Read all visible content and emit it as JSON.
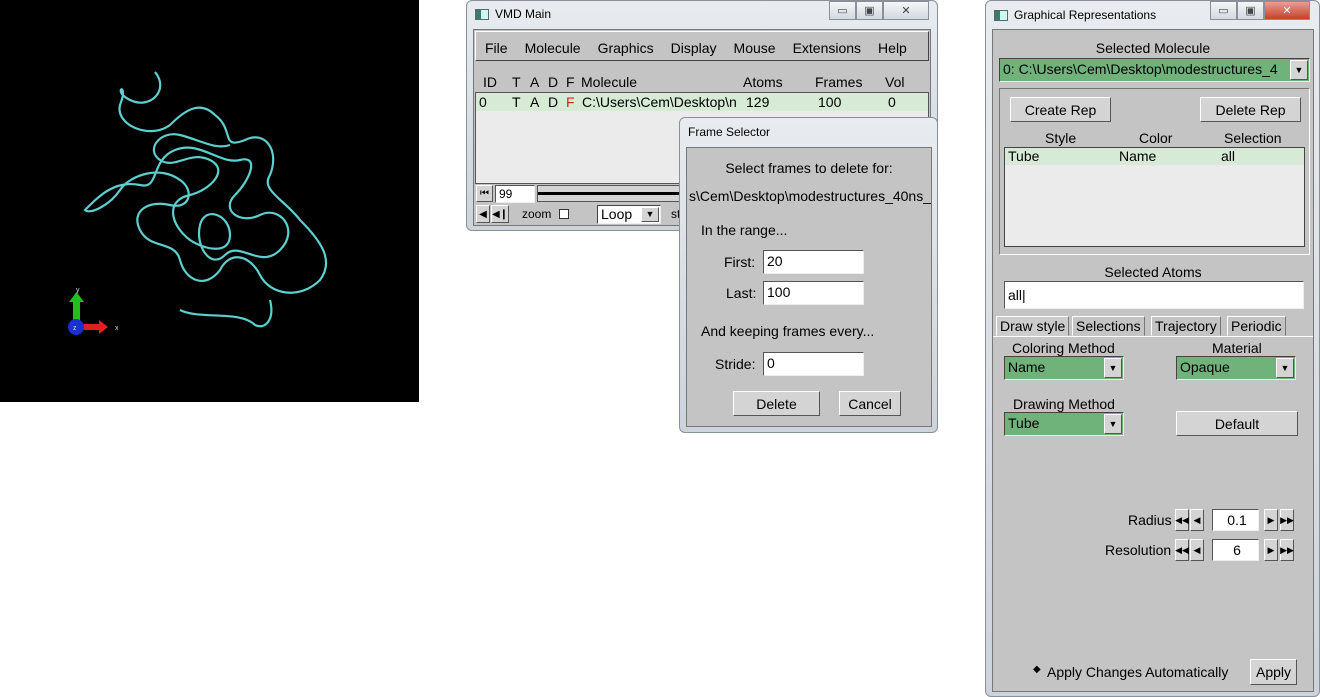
{
  "viewer": {
    "axis_labels": {
      "x": "x",
      "y": "y",
      "z": "z"
    },
    "molecule_color": "#5ccfcf"
  },
  "vmd_main": {
    "title": "VMD Main",
    "menu": [
      "File",
      "Molecule",
      "Graphics",
      "Display",
      "Mouse",
      "Extensions",
      "Help"
    ],
    "columns": [
      "ID",
      "T",
      "A",
      "D",
      "F",
      "Molecule",
      "Atoms",
      "Frames",
      "Vol"
    ],
    "rows": [
      {
        "id": "0",
        "t": "T",
        "a": "A",
        "d": "D",
        "f": "F",
        "molecule": "C:\\Users\\Cem\\Desktop\\n",
        "atoms": "129",
        "frames": "100",
        "vol": "0"
      }
    ],
    "frame_value": "99",
    "zoom_label": "zoom",
    "loop_mode": "Loop",
    "step_label": "st"
  },
  "frame_selector": {
    "title": "Frame Selector",
    "prompt": "Select frames to delete for:",
    "molecule_path": "s\\Cem\\Desktop\\modestructures_40ns_",
    "range_label": "In the range...",
    "first_label": "First:",
    "first_value": "20",
    "last_label": "Last:",
    "last_value": "100",
    "keep_label": "And keeping frames every...",
    "stride_label": "Stride:",
    "stride_value": "0",
    "delete_label": "Delete",
    "cancel_label": "Cancel"
  },
  "graph_reps": {
    "title": "Graphical Representations",
    "selected_molecule_label": "Selected Molecule",
    "selected_molecule": "0: C:\\Users\\Cem\\Desktop\\modestructures_4",
    "create_rep": "Create Rep",
    "delete_rep": "Delete Rep",
    "columns": [
      "Style",
      "Color",
      "Selection"
    ],
    "reps": [
      {
        "style": "Tube",
        "color": "Name",
        "selection": "all"
      }
    ],
    "selected_atoms_label": "Selected Atoms",
    "selected_atoms": "all",
    "tabs": [
      "Draw style",
      "Selections",
      "Trajectory",
      "Periodic"
    ],
    "coloring_method_label": "Coloring Method",
    "coloring_method": "Name",
    "material_label": "Material",
    "material": "Opaque",
    "drawing_method_label": "Drawing Method",
    "drawing_method": "Tube",
    "default_label": "Default",
    "radius_label": "Radius",
    "radius": "0.1",
    "resolution_label": "Resolution",
    "resolution": "6",
    "apply_auto_label": "Apply Changes Automatically",
    "apply_label": "Apply"
  },
  "colors": {
    "selected_row": "#d6ead6",
    "combo_green": "#6fb27a",
    "red_flag": "#e02020"
  }
}
